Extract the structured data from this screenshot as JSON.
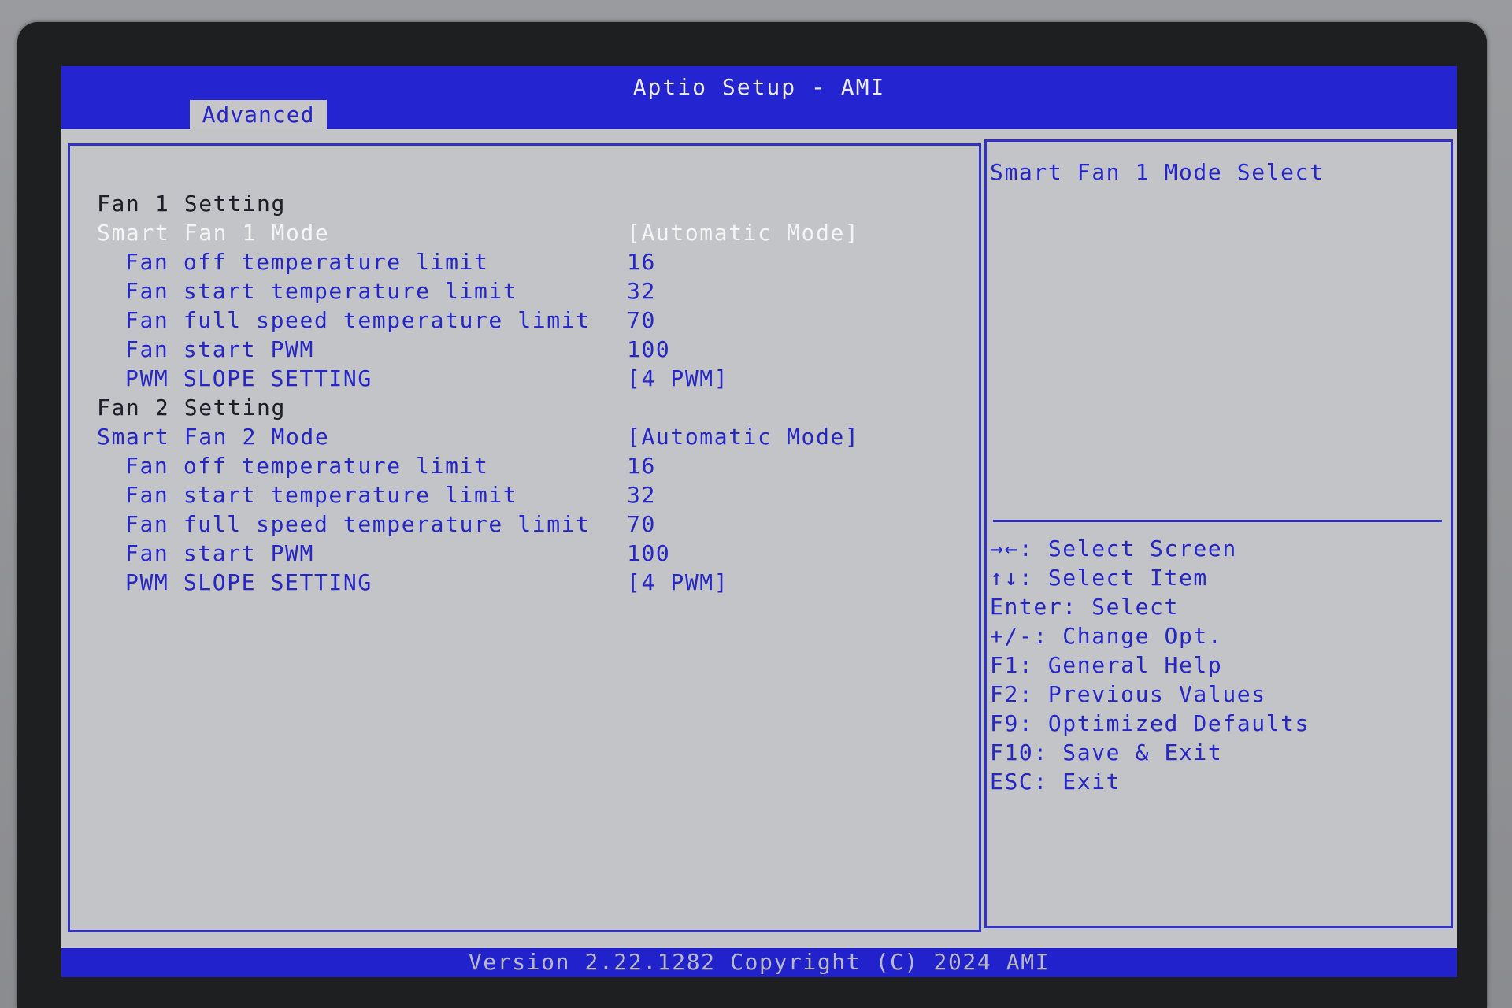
{
  "title": "Aptio Setup - AMI",
  "tabs": [
    {
      "label": "Advanced"
    }
  ],
  "settings": [
    {
      "label": "Fan 1 Setting",
      "value": "",
      "kind": "heading"
    },
    {
      "label": "Smart Fan 1 Mode",
      "value": "[Automatic Mode]",
      "kind": "selected"
    },
    {
      "label": "Fan off temperature limit",
      "value": "16",
      "kind": "sub"
    },
    {
      "label": "Fan start temperature limit",
      "value": "32",
      "kind": "sub"
    },
    {
      "label": "Fan full speed temperature limit",
      "value": "70",
      "kind": "sub"
    },
    {
      "label": "Fan start PWM",
      "value": "100",
      "kind": "sub"
    },
    {
      "label": "PWM SLOPE SETTING",
      "value": "[4 PWM]",
      "kind": "sub"
    },
    {
      "label": "Fan 2 Setting",
      "value": "",
      "kind": "heading"
    },
    {
      "label": "Smart Fan 2 Mode",
      "value": "[Automatic Mode]",
      "kind": "item"
    },
    {
      "label": "Fan off temperature limit",
      "value": "16",
      "kind": "sub"
    },
    {
      "label": "Fan start temperature limit",
      "value": "32",
      "kind": "sub"
    },
    {
      "label": "Fan full speed temperature limit",
      "value": "70",
      "kind": "sub"
    },
    {
      "label": "Fan start PWM",
      "value": "100",
      "kind": "sub"
    },
    {
      "label": "PWM SLOPE SETTING",
      "value": "[4 PWM]",
      "kind": "sub"
    }
  ],
  "help": {
    "description": "Smart Fan 1 Mode Select",
    "keys": [
      "→←: Select Screen",
      "↑↓: Select Item",
      "Enter: Select",
      "+/-: Change Opt.",
      "F1: General Help",
      "F2: Previous Values",
      "F9: Optimized Defaults",
      "F10: Save & Exit",
      "ESC: Exit"
    ]
  },
  "footer": "Version 2.22.1282 Copyright (C) 2024 AMI"
}
